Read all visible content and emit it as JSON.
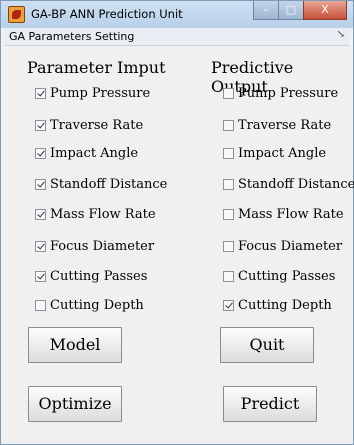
{
  "window": {
    "title": "GA-BP ANN Prediction Unit",
    "controls": {
      "minimize": "–",
      "maximize": "□",
      "close": "X"
    }
  },
  "menubar": {
    "title": "GA Parameters Setting",
    "arrow": "↘"
  },
  "left_panel": {
    "header": "Parameter Imput",
    "items": [
      {
        "label": "Pump Pressure",
        "checked": true
      },
      {
        "label": "Traverse Rate",
        "checked": true
      },
      {
        "label": "Impact Angle",
        "checked": true
      },
      {
        "label": "Standoff Distance",
        "checked": true
      },
      {
        "label": "Mass Flow Rate",
        "checked": true
      },
      {
        "label": "Focus Diameter",
        "checked": true
      },
      {
        "label": "Cutting Passes",
        "checked": true
      },
      {
        "label": "Cutting Depth",
        "checked": false
      }
    ]
  },
  "right_panel": {
    "header": "Predictive Output",
    "items": [
      {
        "label": "Pump Pressure",
        "checked": false
      },
      {
        "label": "Traverse Rate",
        "checked": false
      },
      {
        "label": "Impact Angle",
        "checked": false
      },
      {
        "label": "Standoff Distance",
        "checked": false
      },
      {
        "label": "Mass Flow Rate",
        "checked": false
      },
      {
        "label": "Focus Diameter",
        "checked": false
      },
      {
        "label": "Cutting Passes",
        "checked": false
      },
      {
        "label": "Cutting Depth",
        "checked": true
      }
    ]
  },
  "buttons": {
    "model": "Model",
    "quit": "Quit",
    "optimize": "Optimize",
    "predict": "Predict"
  }
}
